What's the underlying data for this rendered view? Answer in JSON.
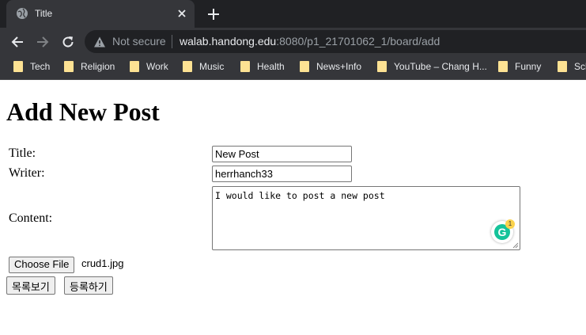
{
  "browser": {
    "tab_title": "Title",
    "not_secure": "Not secure",
    "url_host": "walab.handong.edu",
    "url_path": ":8080/p1_21701062_1/board/add",
    "bookmarks": [
      "Tech",
      "Religion",
      "Work",
      "Music",
      "Health",
      "News+Info",
      "YouTube – Chang H...",
      "Funny",
      "Sch"
    ]
  },
  "page": {
    "title": "Add New Post",
    "labels": {
      "title": "Title:",
      "writer": "Writer:",
      "content": "Content:"
    },
    "fields": {
      "title": "New Post",
      "writer": "herrhanch33",
      "content": "I would like to post a new post"
    },
    "file": {
      "button": "Choose File",
      "name": "crud1.jpg"
    },
    "buttons": {
      "list": "목록보기",
      "submit": "등록하기"
    },
    "grammarly_count": "1"
  }
}
